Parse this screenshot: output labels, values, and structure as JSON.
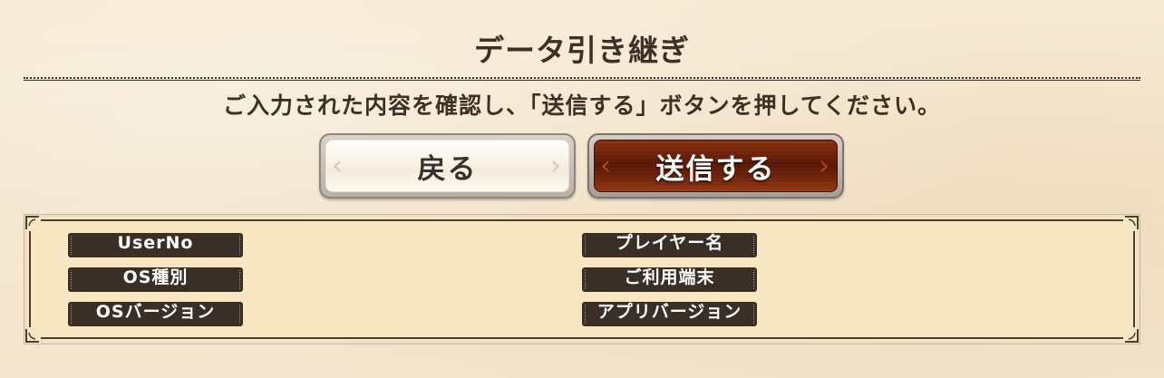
{
  "header": {
    "title": "データ引き継ぎ"
  },
  "instruction": "ご入力された内容を確認し、「送信する」ボタンを押してください。",
  "buttons": {
    "back_label": "戻る",
    "send_label": "送信する"
  },
  "info": {
    "fields": [
      {
        "label": "UserNo",
        "value": ""
      },
      {
        "label": "プレイヤー名",
        "value": ""
      },
      {
        "label": "OS種別",
        "value": ""
      },
      {
        "label": "ご利用端末",
        "value": ""
      },
      {
        "label": "OSバージョン",
        "value": ""
      },
      {
        "label": "アプリバージョン",
        "value": ""
      }
    ]
  },
  "colors": {
    "send_button": "#6f250c",
    "back_button": "#fbf5ea",
    "panel_background": "#f9e7c3",
    "label_background": "#3a2f27",
    "text": "#3d3126"
  },
  "icons": {
    "button_decoration": "chevron-ornament-icon",
    "panel_corner": "corner-ornament-icon"
  }
}
